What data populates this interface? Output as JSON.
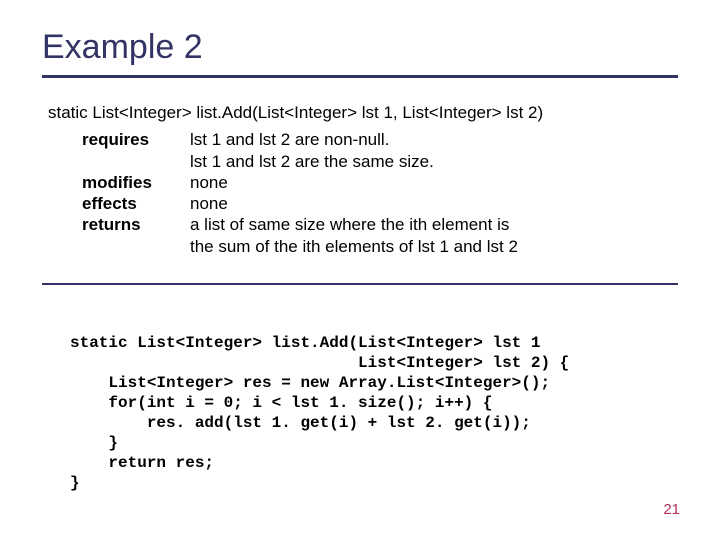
{
  "title": "Example 2",
  "signature": "static List<Integer> list.Add(List<Integer> lst 1, List<Integer> lst 2)",
  "spec": {
    "requires": {
      "label": "requires",
      "text1": "lst 1 and lst 2 are non-null.",
      "text2": "lst 1 and lst 2 are the same size."
    },
    "modifies": {
      "label": "modifies",
      "text": "none"
    },
    "effects": {
      "label": "effects",
      "text": "none"
    },
    "returns": {
      "label": "returns",
      "text1": "a list of same size where the ith element is",
      "text2": "the sum of the ith elements of lst 1 and lst 2"
    }
  },
  "code": {
    "l1": "static List<Integer> list.Add(List<Integer> lst 1",
    "l2": "                              List<Integer> lst 2) {",
    "l3": "    List<Integer> res = new Array.List<Integer>();",
    "l4": "    for(int i = 0; i < lst 1. size(); i++) {",
    "l5": "        res. add(lst 1. get(i) + lst 2. get(i));",
    "l6": "    }",
    "l7": "    return res;",
    "l8": "}"
  },
  "page_number": "21"
}
